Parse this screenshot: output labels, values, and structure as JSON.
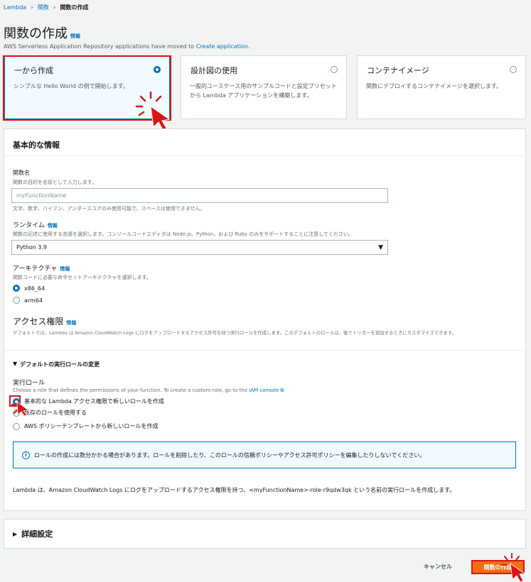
{
  "breadcrumb": {
    "root": "Lambda",
    "section": "関数",
    "current": "関数の作成"
  },
  "page": {
    "title": "関数の作成",
    "info": "情報",
    "notice_prefix": "AWS Serverless Application Repository applications have moved to ",
    "notice_link": "Create application",
    "notice_suffix": "."
  },
  "options": [
    {
      "title": "一から作成",
      "desc": "シンプルな Hello World の例で開始します。",
      "selected": true
    },
    {
      "title": "設計図の使用",
      "desc": "一般的ユースケース用のサンプルコードと設定プリセットから Lambda アプリケーションを構築します。",
      "selected": false
    },
    {
      "title": "コンテナイメージ",
      "desc": "関数にデプロイするコンテナイメージを選択します。",
      "selected": false
    }
  ],
  "basic": {
    "header": "基本的な情報",
    "fn_label": "関数名",
    "fn_desc": "関数の目的を名前として入力します。",
    "fn_placeholder": "myFunctionName",
    "fn_hint": "文字、数字、ハイフン、アンダースコアのみ使用可能で、スペースは使用できません。",
    "runtime_label": "ランタイム",
    "runtime_info": "情報",
    "runtime_desc": "関数の記述に使用する言語を選択します。コンソールコードエディタは Node.js、Python、および Ruby のみをサポートすることに注意してください。",
    "runtime_value": "Python 3.9",
    "arch_label": "アーキテクチャ",
    "arch_info": "情報",
    "arch_desc": "関数コードに必要な命令セットアーキテクチャを選択します。",
    "arch_options": [
      "x86_64",
      "arm64"
    ],
    "perm_label": "アクセス権限",
    "perm_info": "情報",
    "perm_desc": "デフォルトでは、Lambda は Amazon CloudWatch Logs にログをアップロードするアクセス許可を持つ実行ロールを作成します。このデフォルトのロールは、後でトリガーを追加するときにカスタマイズできます。",
    "role_toggle": "デフォルトの実行ロールの変更",
    "role_label": "実行ロール",
    "role_desc_prefix": "Choose a role that defines the permissions of your function. To create a custom role, go to the ",
    "role_desc_link": "IAM console",
    "role_options": [
      "基本的な Lambda アクセス権限で新しいロールを作成",
      "既存のロールを使用する",
      "AWS ポリシーテンプレートから新しいロールを作成"
    ],
    "info_text": "ロールの作成には数分かかる場合があります。ロールを削除したり、このロールの信頼ポリシーやアクセス許可ポリシーを編集したりしないでください。",
    "footer_text": "Lambda は、Amazon CloudWatch Logs にログをアップロードするアクセス権限を持つ、<myFunctionName>-role-r9qdw3qk という名前の実行ロールを作成します。"
  },
  "advanced": {
    "label": "詳細設定"
  },
  "actions": {
    "cancel": "キャンセル",
    "create": "関数の作成"
  },
  "colors": {
    "accent": "#0073bb",
    "primary": "#ec7211",
    "highlight": "#d91515"
  }
}
